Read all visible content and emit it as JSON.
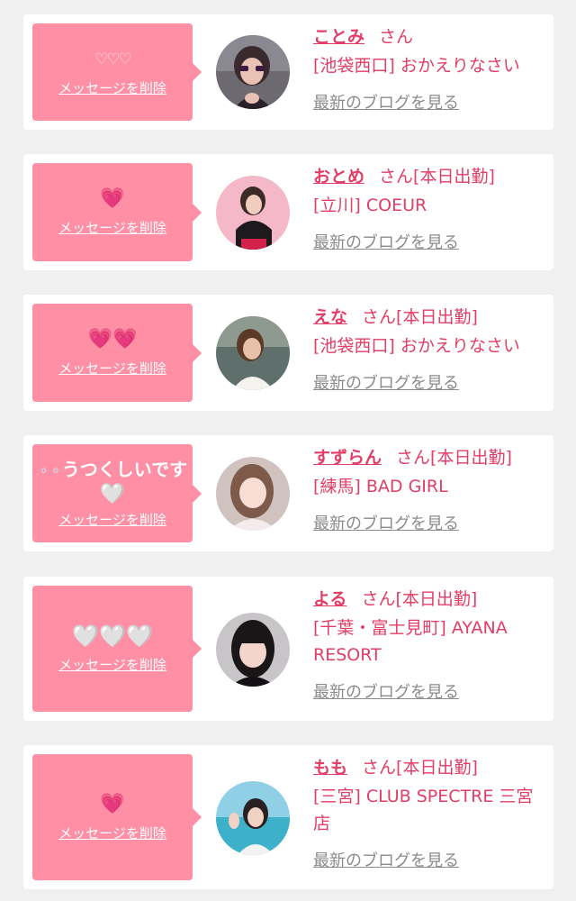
{
  "delete_label": "メッセージを削除",
  "blog_label": "最新のブログを見る",
  "san_label": "さん",
  "colors": {
    "background": "#f0f0f1",
    "bubble": "#ff8fa5",
    "accent_text": "#e23e67",
    "link_gray": "#8b8b8b"
  },
  "items": [
    {
      "message": "♡♡♡",
      "name": "ことみ",
      "status": "",
      "shop": "[池袋西口] おかえりなさい"
    },
    {
      "message": "💗",
      "name": "おとめ",
      "status": "[本日出勤]",
      "shop": "[立川] COEUR"
    },
    {
      "message": "💗💗",
      "name": "えな",
      "status": "[本日出勤]",
      "shop": "[池袋西口] おかえりなさい"
    },
    {
      "message_line1": "うつくしいです",
      "message_line2": "🤍",
      "name": "すずらん",
      "status": "[本日出勤]",
      "shop": "[練馬] BAD GIRL"
    },
    {
      "message": "🤍🤍🤍",
      "name": "よる",
      "status": "[本日出勤]",
      "shop": "[千葉・富士見町] AYANA RESORT"
    },
    {
      "message": "💗",
      "name": "もも",
      "status": "[本日出勤]",
      "shop": "[三宮] CLUB SPECTRE 三宮店"
    }
  ]
}
